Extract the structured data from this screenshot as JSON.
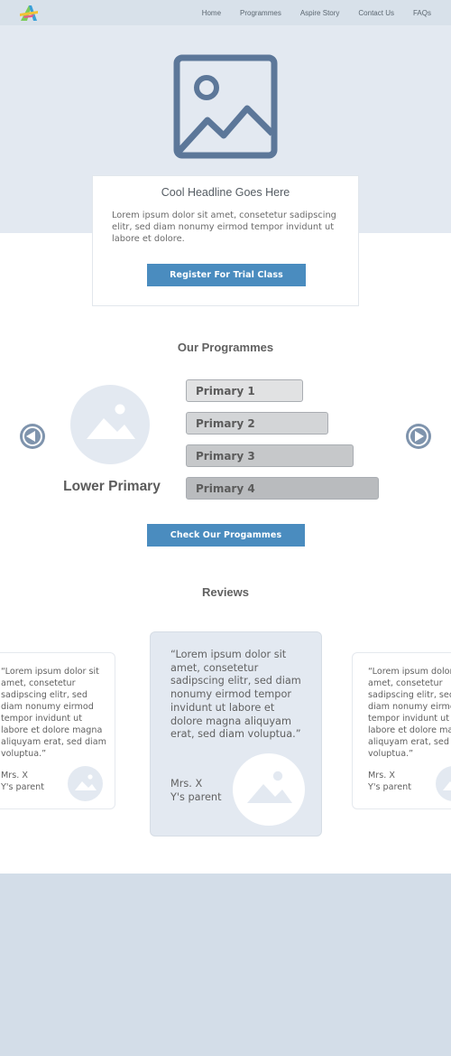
{
  "header": {
    "logo": "aspire-logo-icon",
    "nav": [
      "Home",
      "Programmes",
      "Aspire Story",
      "Contact Us",
      "FAQs"
    ]
  },
  "hero": {
    "image_icon": "image-placeholder-icon",
    "headline": "Cool Headline Goes Here",
    "body": "Lorem ipsum dolor sit amet, consetetur sadipscing elitr, sed diam nonumy eirmod tempor invidunt ut labore et dolore.",
    "cta_label": "Register For Trial Class"
  },
  "programmes": {
    "title": "Our Programmes",
    "current": "Lower Primary",
    "levels": [
      "Primary 1",
      "Primary 2",
      "Primary 3",
      "Primary 4"
    ],
    "cta_label": "Check Our Progammes"
  },
  "reviews": {
    "title": "Reviews",
    "items": [
      {
        "quote": "“Lorem ipsum dolor sit amet, consetetur sadipscing elitr, sed diam nonumy eirmod tempor invidunt ut labore et dolore magna aliquyam erat, sed diam voluptua.”",
        "author": "Mrs. X",
        "relation": "Y's parent"
      },
      {
        "quote": "“Lorem ipsum dolor sit amet, consetetur sadipscing elitr, sed diam nonumy eirmod tempor invidunt ut labore et dolore magna aliquyam erat, sed diam voluptua.”",
        "author": "Mrs. X",
        "relation": "Y's parent"
      },
      {
        "quote": "“Lorem ipsum dolor sit amet, consetetur sadipscing elitr, sed diam nonumy eirmod tempor invidunt ut labore et dolore magna aliquyam erat, sed diam voluptua.”",
        "author": "Mrs. X",
        "relation": "Y's parent"
      }
    ]
  },
  "colors": {
    "header_bg": "#d8e1ea",
    "hero_bg": "#e3e9f1",
    "accent_button": "#4a8cbf",
    "arrow": "#7f94ad",
    "footer_bg": "#d3dde8"
  }
}
